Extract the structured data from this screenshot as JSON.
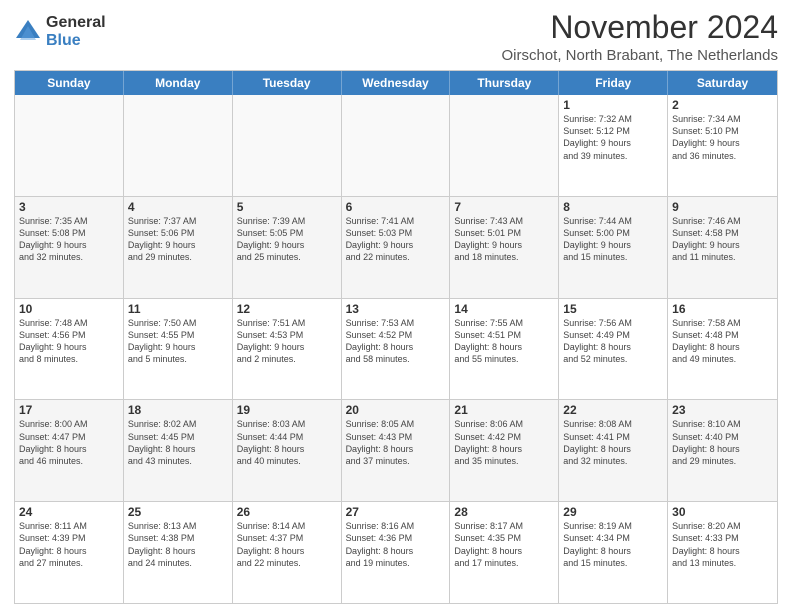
{
  "logo": {
    "general": "General",
    "blue": "Blue"
  },
  "header": {
    "month": "November 2024",
    "location": "Oirschot, North Brabant, The Netherlands"
  },
  "days": [
    "Sunday",
    "Monday",
    "Tuesday",
    "Wednesday",
    "Thursday",
    "Friday",
    "Saturday"
  ],
  "weeks": [
    [
      {
        "day": "",
        "lines": []
      },
      {
        "day": "",
        "lines": []
      },
      {
        "day": "",
        "lines": []
      },
      {
        "day": "",
        "lines": []
      },
      {
        "day": "",
        "lines": []
      },
      {
        "day": "1",
        "lines": [
          "Sunrise: 7:32 AM",
          "Sunset: 5:12 PM",
          "Daylight: 9 hours",
          "and 39 minutes."
        ]
      },
      {
        "day": "2",
        "lines": [
          "Sunrise: 7:34 AM",
          "Sunset: 5:10 PM",
          "Daylight: 9 hours",
          "and 36 minutes."
        ]
      }
    ],
    [
      {
        "day": "3",
        "lines": [
          "Sunrise: 7:35 AM",
          "Sunset: 5:08 PM",
          "Daylight: 9 hours",
          "and 32 minutes."
        ]
      },
      {
        "day": "4",
        "lines": [
          "Sunrise: 7:37 AM",
          "Sunset: 5:06 PM",
          "Daylight: 9 hours",
          "and 29 minutes."
        ]
      },
      {
        "day": "5",
        "lines": [
          "Sunrise: 7:39 AM",
          "Sunset: 5:05 PM",
          "Daylight: 9 hours",
          "and 25 minutes."
        ]
      },
      {
        "day": "6",
        "lines": [
          "Sunrise: 7:41 AM",
          "Sunset: 5:03 PM",
          "Daylight: 9 hours",
          "and 22 minutes."
        ]
      },
      {
        "day": "7",
        "lines": [
          "Sunrise: 7:43 AM",
          "Sunset: 5:01 PM",
          "Daylight: 9 hours",
          "and 18 minutes."
        ]
      },
      {
        "day": "8",
        "lines": [
          "Sunrise: 7:44 AM",
          "Sunset: 5:00 PM",
          "Daylight: 9 hours",
          "and 15 minutes."
        ]
      },
      {
        "day": "9",
        "lines": [
          "Sunrise: 7:46 AM",
          "Sunset: 4:58 PM",
          "Daylight: 9 hours",
          "and 11 minutes."
        ]
      }
    ],
    [
      {
        "day": "10",
        "lines": [
          "Sunrise: 7:48 AM",
          "Sunset: 4:56 PM",
          "Daylight: 9 hours",
          "and 8 minutes."
        ]
      },
      {
        "day": "11",
        "lines": [
          "Sunrise: 7:50 AM",
          "Sunset: 4:55 PM",
          "Daylight: 9 hours",
          "and 5 minutes."
        ]
      },
      {
        "day": "12",
        "lines": [
          "Sunrise: 7:51 AM",
          "Sunset: 4:53 PM",
          "Daylight: 9 hours",
          "and 2 minutes."
        ]
      },
      {
        "day": "13",
        "lines": [
          "Sunrise: 7:53 AM",
          "Sunset: 4:52 PM",
          "Daylight: 8 hours",
          "and 58 minutes."
        ]
      },
      {
        "day": "14",
        "lines": [
          "Sunrise: 7:55 AM",
          "Sunset: 4:51 PM",
          "Daylight: 8 hours",
          "and 55 minutes."
        ]
      },
      {
        "day": "15",
        "lines": [
          "Sunrise: 7:56 AM",
          "Sunset: 4:49 PM",
          "Daylight: 8 hours",
          "and 52 minutes."
        ]
      },
      {
        "day": "16",
        "lines": [
          "Sunrise: 7:58 AM",
          "Sunset: 4:48 PM",
          "Daylight: 8 hours",
          "and 49 minutes."
        ]
      }
    ],
    [
      {
        "day": "17",
        "lines": [
          "Sunrise: 8:00 AM",
          "Sunset: 4:47 PM",
          "Daylight: 8 hours",
          "and 46 minutes."
        ]
      },
      {
        "day": "18",
        "lines": [
          "Sunrise: 8:02 AM",
          "Sunset: 4:45 PM",
          "Daylight: 8 hours",
          "and 43 minutes."
        ]
      },
      {
        "day": "19",
        "lines": [
          "Sunrise: 8:03 AM",
          "Sunset: 4:44 PM",
          "Daylight: 8 hours",
          "and 40 minutes."
        ]
      },
      {
        "day": "20",
        "lines": [
          "Sunrise: 8:05 AM",
          "Sunset: 4:43 PM",
          "Daylight: 8 hours",
          "and 37 minutes."
        ]
      },
      {
        "day": "21",
        "lines": [
          "Sunrise: 8:06 AM",
          "Sunset: 4:42 PM",
          "Daylight: 8 hours",
          "and 35 minutes."
        ]
      },
      {
        "day": "22",
        "lines": [
          "Sunrise: 8:08 AM",
          "Sunset: 4:41 PM",
          "Daylight: 8 hours",
          "and 32 minutes."
        ]
      },
      {
        "day": "23",
        "lines": [
          "Sunrise: 8:10 AM",
          "Sunset: 4:40 PM",
          "Daylight: 8 hours",
          "and 29 minutes."
        ]
      }
    ],
    [
      {
        "day": "24",
        "lines": [
          "Sunrise: 8:11 AM",
          "Sunset: 4:39 PM",
          "Daylight: 8 hours",
          "and 27 minutes."
        ]
      },
      {
        "day": "25",
        "lines": [
          "Sunrise: 8:13 AM",
          "Sunset: 4:38 PM",
          "Daylight: 8 hours",
          "and 24 minutes."
        ]
      },
      {
        "day": "26",
        "lines": [
          "Sunrise: 8:14 AM",
          "Sunset: 4:37 PM",
          "Daylight: 8 hours",
          "and 22 minutes."
        ]
      },
      {
        "day": "27",
        "lines": [
          "Sunrise: 8:16 AM",
          "Sunset: 4:36 PM",
          "Daylight: 8 hours",
          "and 19 minutes."
        ]
      },
      {
        "day": "28",
        "lines": [
          "Sunrise: 8:17 AM",
          "Sunset: 4:35 PM",
          "Daylight: 8 hours",
          "and 17 minutes."
        ]
      },
      {
        "day": "29",
        "lines": [
          "Sunrise: 8:19 AM",
          "Sunset: 4:34 PM",
          "Daylight: 8 hours",
          "and 15 minutes."
        ]
      },
      {
        "day": "30",
        "lines": [
          "Sunrise: 8:20 AM",
          "Sunset: 4:33 PM",
          "Daylight: 8 hours",
          "and 13 minutes."
        ]
      }
    ]
  ],
  "colors": {
    "header_bg": "#3a7fc1",
    "alt_row": "#f5f5f5",
    "empty_bg": "#f9f9f9"
  }
}
